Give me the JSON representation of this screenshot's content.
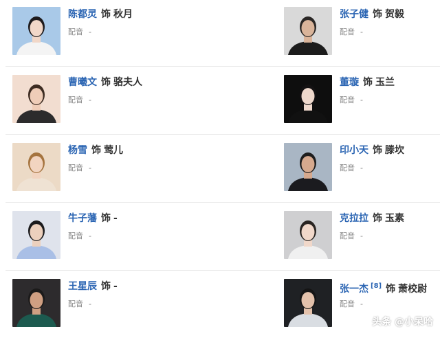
{
  "cast": [
    {
      "left": {
        "actor": "陈都灵",
        "play": "饰",
        "role": "秋月",
        "dub_label": "配音",
        "dub_value": "-",
        "photo": {
          "bg": "#a9c9e8",
          "hair": "#1d1a1c",
          "skin": "#f1d7c8",
          "cloth": "#f4f4f4"
        }
      },
      "right": {
        "actor": "张子健",
        "play": "饰",
        "role": "贺毅",
        "dub_label": "配音",
        "dub_value": "-",
        "photo": {
          "bg": "#d9d9d9",
          "hair": "#2a2725",
          "skin": "#d9b49a",
          "cloth": "#1c1c1c"
        }
      }
    },
    {
      "left": {
        "actor": "曹曦文",
        "play": "饰",
        "role": "骆夫人",
        "dub_label": "配音",
        "dub_value": "-",
        "photo": {
          "bg": "#f2ddd0",
          "hair": "#3d2c22",
          "skin": "#efcdb8",
          "cloth": "#2c2b2c"
        }
      },
      "right": {
        "actor": "董璇",
        "play": "饰",
        "role": "玉兰",
        "dub_label": "配音",
        "dub_value": "-",
        "photo": {
          "bg": "#0e0e0e",
          "hair": "#141213",
          "skin": "#eed8cc",
          "cloth": "#111111"
        }
      }
    },
    {
      "left": {
        "actor": "杨雪",
        "play": "饰",
        "role": "莺儿",
        "dub_label": "配音",
        "dub_value": "-",
        "photo": {
          "bg": "#ecdac6",
          "hair": "#a5743f",
          "skin": "#f2d4c0",
          "cloth": "#efe2d3"
        }
      },
      "right": {
        "actor": "印小天",
        "play": "饰",
        "role": "滕坎",
        "dub_label": "配音",
        "dub_value": "-",
        "photo": {
          "bg": "#a9b6c4",
          "hair": "#1f1e1e",
          "skin": "#d6a98e",
          "cloth": "#1b1b1f"
        }
      }
    },
    {
      "left": {
        "actor": "牛子藩",
        "play": "饰",
        "role": "-",
        "dub_label": "配音",
        "dub_value": "-",
        "photo": {
          "bg": "#dfe3ec",
          "hair": "#1b1b1d",
          "skin": "#ecd0bd",
          "cloth": "#a9bfe6"
        }
      },
      "right": {
        "actor": "克拉拉",
        "play": "饰",
        "role": "玉素",
        "dub_label": "配音",
        "dub_value": "-",
        "photo": {
          "bg": "#cfcfd1",
          "hair": "#2a2522",
          "skin": "#f1d8ca",
          "cloth": "#f0f0f0"
        }
      }
    },
    {
      "left": {
        "actor": "王星辰",
        "play": "饰",
        "role": "-",
        "dub_label": "配音",
        "dub_value": "-",
        "photo": {
          "bg": "#2d2b2d",
          "hair": "#1b1a1a",
          "skin": "#cf9f82",
          "cloth": "#1c5a4f"
        }
      },
      "right": {
        "actor": "张一杰",
        "sup": "[8]",
        "play": "饰",
        "role": "萧校尉",
        "dub_label": "配音",
        "dub_value": "-",
        "photo": {
          "bg": "#1f2124",
          "hair": "#151515",
          "skin": "#e3c1ab",
          "cloth": "#d9dde2"
        }
      }
    }
  ],
  "watermark": "头条 @小呆哈",
  "colors": {
    "actor_link": "#2b65b3",
    "divider": "#e6e6e6",
    "dub_text": "#888888"
  }
}
